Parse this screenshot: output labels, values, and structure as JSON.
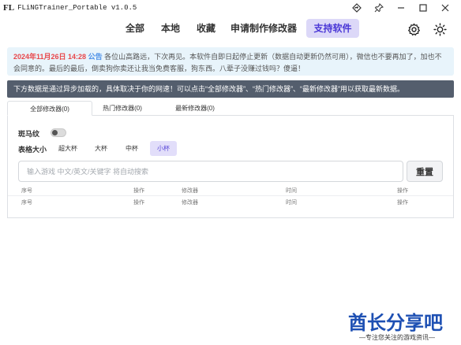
{
  "window": {
    "logo": "FL",
    "title": "FLiNGTrainer_Portable v1.0.5"
  },
  "nav": {
    "items": [
      {
        "label": "全部"
      },
      {
        "label": "本地"
      },
      {
        "label": "收藏"
      },
      {
        "label": "申请制作修改器"
      },
      {
        "label": "支持软件",
        "active": true
      }
    ],
    "icons": [
      "settings-gear-icon",
      "theme-sun-icon"
    ]
  },
  "notice": {
    "date": "2024年11月26日 14:28",
    "tag": "公告",
    "text": "各位山高路远，下次再见。本软件自即日起停止更新（数据自动更新仍然可用），微信也不要再加了，加也不会同意的。最后的最后，倒卖狗你卖还让我当免费客服，狗东西。八辈子没赚过钱吗？傻逼！"
  },
  "info_bar": {
    "text": "下方数据是通过异步加载的，具体取决于你的网速！可以点击“全部修改器”、“热门修改器”、“最新修改器”用以获取最新数据。"
  },
  "tabs": [
    {
      "label": "全部修改器(0)",
      "active": true
    },
    {
      "label": "热门修改器(0)"
    },
    {
      "label": "最新修改器(0)"
    }
  ],
  "filters": {
    "marquee_label": "斑马纹",
    "marquee_on": false,
    "size_label": "表格大小",
    "sizes": [
      {
        "label": "超大杯"
      },
      {
        "label": "大杯"
      },
      {
        "label": "中杯"
      },
      {
        "label": "小杯",
        "active": true
      }
    ]
  },
  "search": {
    "placeholder": "输入游戏 中文/英文/关键字 将自动搜索",
    "value": "",
    "reset_label": "重置"
  },
  "table": {
    "columns": [
      "序号",
      "操作",
      "修改器",
      "时间",
      "操作"
    ]
  },
  "watermark": {
    "main": "酋长分享吧",
    "sub": "—专注您关注的游戏资讯—"
  }
}
